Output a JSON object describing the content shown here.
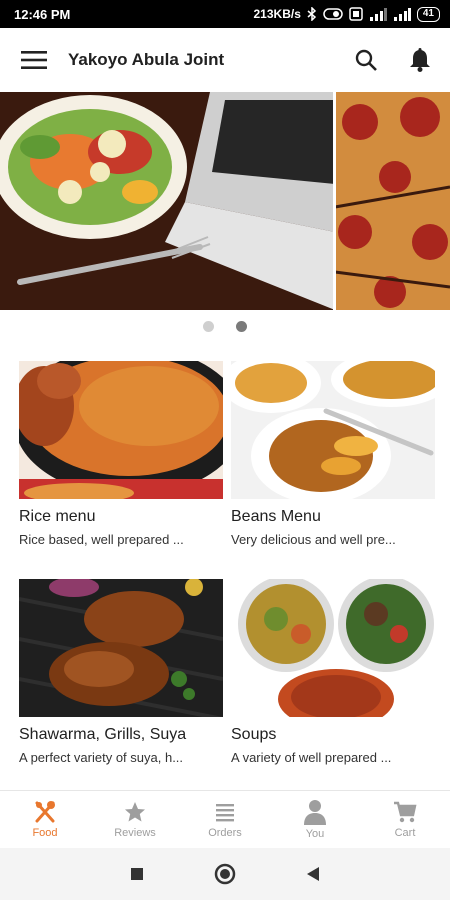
{
  "status_bar": {
    "time": "12:46 PM",
    "speed": "213KB/s",
    "battery": "41"
  },
  "app_bar": {
    "title": "Yakoyo Abula Joint"
  },
  "banner": {
    "slide_count": 2,
    "active_index": 1
  },
  "menus": [
    {
      "title": "Rice menu",
      "description": "Rice based, well prepared ..."
    },
    {
      "title": "Beans Menu",
      "description": "Very delicious and well pre..."
    },
    {
      "title": "Shawarma, Grills, Suya",
      "description": "A perfect variety of suya, h..."
    },
    {
      "title": "Soups",
      "description": "A variety of well prepared ..."
    }
  ],
  "bottom_nav": [
    {
      "label": "Food",
      "icon": "fork-knife-icon",
      "active": true
    },
    {
      "label": "Reviews",
      "icon": "star-icon",
      "active": false
    },
    {
      "label": "Orders",
      "icon": "list-icon",
      "active": false
    },
    {
      "label": "You",
      "icon": "person-icon",
      "active": false
    },
    {
      "label": "Cart",
      "icon": "cart-icon",
      "active": false
    }
  ],
  "colors": {
    "accent": "#e8772e",
    "inactive": "#9e9e9e"
  }
}
